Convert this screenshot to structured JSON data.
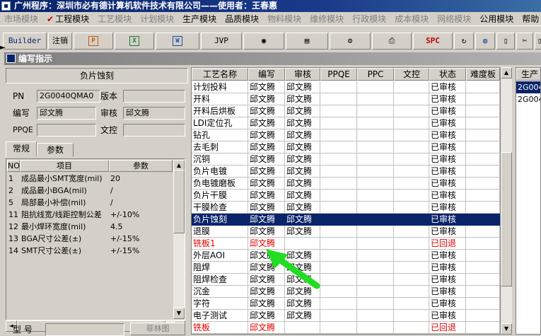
{
  "window_title": "广州程序：深圳市必有德计算机软件技术有限公司——使用者：王春惠",
  "menu": [
    {
      "label": "市场模块",
      "enabled": false
    },
    {
      "label": "工程模块",
      "enabled": true,
      "checked": true
    },
    {
      "label": "工艺模块",
      "enabled": false
    },
    {
      "label": "计划模块",
      "enabled": false
    },
    {
      "label": "生产模块",
      "enabled": true
    },
    {
      "label": "品质模块",
      "enabled": true
    },
    {
      "label": "物料模块",
      "enabled": false
    },
    {
      "label": "维修模块",
      "enabled": false
    },
    {
      "label": "行政模块",
      "enabled": false
    },
    {
      "label": "成本模块",
      "enabled": false
    },
    {
      "label": "网络模块",
      "enabled": false
    },
    {
      "label": "公用模块",
      "enabled": true
    },
    {
      "label": "帮助",
      "enabled": true
    }
  ],
  "toolbar": {
    "builder": "Builder",
    "logout": "注销",
    "jvp": "JVP",
    "spc": "SPC"
  },
  "child_window_title": "编写指示",
  "corner_mark": "►",
  "left": {
    "group_title": "负片蚀刻",
    "pn_label": "PN",
    "pn_value": "2G0040QMA0",
    "version_label": "版本",
    "version_value": "",
    "writer_label": "编写",
    "writer_value": "邱文腾",
    "reviewer_label": "审核",
    "reviewer_value": "邱文腾",
    "ppqe_label": "PPQE",
    "ppqe_value": "",
    "doc_control_label": "文控",
    "doc_control_value": "",
    "tabs": [
      "常规",
      "参数"
    ],
    "active_tab": 0,
    "param_headers": [
      "NO",
      "项目",
      "参数"
    ],
    "params": [
      {
        "no": "1",
        "item": "成品最小SMT宽度(mil)",
        "value": "20"
      },
      {
        "no": "2",
        "item": "成品最小BGA(mil)",
        "value": "/"
      },
      {
        "no": "5",
        "item": "局部最小补偿(mil)",
        "value": "/"
      },
      {
        "no": "11",
        "item": "阻抗线宽/线距控制公差",
        "value": "+/-10%"
      },
      {
        "no": "12",
        "item": "最小焊环宽度(mil)",
        "value": "4.5"
      },
      {
        "no": "13",
        "item": "BGA尺寸公差(±)",
        "value": "+/-15%"
      },
      {
        "no": "14",
        "item": "SMT尺寸公差(±)",
        "value": "+/-15%"
      }
    ],
    "type_label": "型 号",
    "type_value": "",
    "film_button": "菲林图"
  },
  "grid": {
    "headers": [
      "工艺名称",
      "编写",
      "审核",
      "PPQE",
      "PPC",
      "文控",
      "状态",
      "难度板"
    ],
    "rows": [
      {
        "name": "计划投料",
        "writer": "邱文腾",
        "reviewer": "邱文腾",
        "ppqe": "",
        "ppc": "",
        "doc": "",
        "status": "已审核",
        "style": ""
      },
      {
        "name": "开料",
        "writer": "邱文腾",
        "reviewer": "邱文腾",
        "ppqe": "",
        "ppc": "",
        "doc": "",
        "status": "已审核",
        "style": ""
      },
      {
        "name": "开料后烘板",
        "writer": "邱文腾",
        "reviewer": "邱文腾",
        "ppqe": "",
        "ppc": "",
        "doc": "",
        "status": "已审核",
        "style": ""
      },
      {
        "name": "LDI定位孔",
        "writer": "邱文腾",
        "reviewer": "邱文腾",
        "ppqe": "",
        "ppc": "",
        "doc": "",
        "status": "已审核",
        "style": ""
      },
      {
        "name": "钻孔",
        "writer": "邱文腾",
        "reviewer": "邱文腾",
        "ppqe": "",
        "ppc": "",
        "doc": "",
        "status": "已审核",
        "style": ""
      },
      {
        "name": "去毛刺",
        "writer": "邱文腾",
        "reviewer": "邱文腾",
        "ppqe": "",
        "ppc": "",
        "doc": "",
        "status": "已审核",
        "style": ""
      },
      {
        "name": "沉铜",
        "writer": "邱文腾",
        "reviewer": "邱文腾",
        "ppqe": "",
        "ppc": "",
        "doc": "",
        "status": "已审核",
        "style": ""
      },
      {
        "name": "负片电镀",
        "writer": "邱文腾",
        "reviewer": "邱文腾",
        "ppqe": "",
        "ppc": "",
        "doc": "",
        "status": "已审核",
        "style": ""
      },
      {
        "name": "负电镀磨板",
        "writer": "邱文腾",
        "reviewer": "邱文腾",
        "ppqe": "",
        "ppc": "",
        "doc": "",
        "status": "已审核",
        "style": ""
      },
      {
        "name": "负片干膜",
        "writer": "邱文腾",
        "reviewer": "邱文腾",
        "ppqe": "",
        "ppc": "",
        "doc": "",
        "status": "已审核",
        "style": ""
      },
      {
        "name": "干膜检查",
        "writer": "邱文腾",
        "reviewer": "邱文腾",
        "ppqe": "",
        "ppc": "",
        "doc": "",
        "status": "已审核",
        "style": ""
      },
      {
        "name": "负片蚀刻",
        "writer": "邱文腾",
        "reviewer": "邱文腾",
        "ppqe": "",
        "ppc": "",
        "doc": "",
        "status": "已审核",
        "style": "sel"
      },
      {
        "name": "退膜",
        "writer": "邱文腾",
        "reviewer": "邱文腾",
        "ppqe": "",
        "ppc": "",
        "doc": "",
        "status": "已审核",
        "style": ""
      },
      {
        "name": "铣板1",
        "writer": "邱文腾",
        "reviewer": "",
        "ppqe": "",
        "ppc": "",
        "doc": "",
        "status": "已回退",
        "style": "red"
      },
      {
        "name": "外层AOI",
        "writer": "邱文腾",
        "reviewer": "邱文腾",
        "ppqe": "",
        "ppc": "",
        "doc": "",
        "status": "已审核",
        "style": ""
      },
      {
        "name": "阻焊",
        "writer": "邱文腾",
        "reviewer": "邱文腾",
        "ppqe": "",
        "ppc": "",
        "doc": "",
        "status": "已审核",
        "style": ""
      },
      {
        "name": "阻焊检查",
        "writer": "邱文腾",
        "reviewer": "邱文腾",
        "ppqe": "",
        "ppc": "",
        "doc": "",
        "status": "已审核",
        "style": ""
      },
      {
        "name": "沉金",
        "writer": "邱文腾",
        "reviewer": "邱文腾",
        "ppqe": "",
        "ppc": "",
        "doc": "",
        "status": "已审核",
        "style": ""
      },
      {
        "name": "字符",
        "writer": "邱文腾",
        "reviewer": "邱文腾",
        "ppqe": "",
        "ppc": "",
        "doc": "",
        "status": "已审核",
        "style": ""
      },
      {
        "name": "电子测试",
        "writer": "邱文腾",
        "reviewer": "邱文腾",
        "ppqe": "",
        "ppc": "",
        "doc": "",
        "status": "已审核",
        "style": ""
      },
      {
        "name": "铣板",
        "writer": "邱文腾",
        "reviewer": "",
        "ppqe": "",
        "ppc": "",
        "doc": "",
        "status": "已回退",
        "style": "red"
      }
    ]
  },
  "right_list": {
    "header": "生产",
    "rows": [
      {
        "value": "2G004",
        "selected": true
      },
      {
        "value": "2G004",
        "selected": false
      }
    ]
  },
  "colors": {
    "selection": "#0a246a",
    "returned_text": "#e00000",
    "annotation_arrow": "#22dd22"
  }
}
